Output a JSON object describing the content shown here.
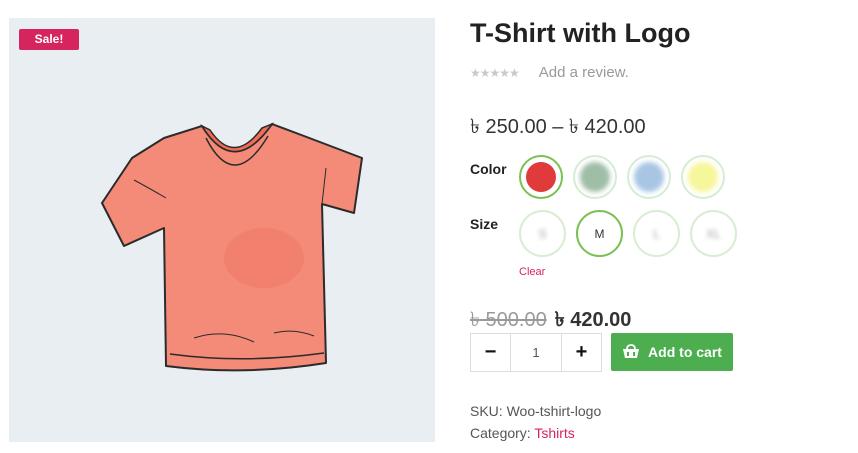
{
  "badge": {
    "sale_label": "Sale!"
  },
  "product": {
    "title": "T-Shirt with Logo",
    "rating_stars": "★★★★★",
    "review_link": "Add a review.",
    "price_range": "৳ 250.00 – ৳ 420.00",
    "old_price": "৳ 500.00",
    "new_price": "৳ 420.00"
  },
  "attributes": {
    "color_label": "Color",
    "colors": [
      {
        "name": "red",
        "hex": "#e03a3a",
        "selected": true
      },
      {
        "name": "green",
        "hex": "#7fa98a",
        "selected": false
      },
      {
        "name": "blue",
        "hex": "#8bb4dc",
        "selected": false
      },
      {
        "name": "yellow",
        "hex": "#f3f37a",
        "selected": false
      }
    ],
    "size_label": "Size",
    "sizes": [
      "S",
      "M",
      "L",
      "XL"
    ],
    "selected_size": "M",
    "clear_label": "Clear"
  },
  "cart": {
    "minus_label": "−",
    "plus_label": "+",
    "quantity": "1",
    "add_to_cart_label": "Add to cart"
  },
  "meta": {
    "sku_label": "SKU:",
    "sku_value": "Woo-tshirt-logo",
    "category_label": "Category:",
    "category_value": "Tshirts"
  },
  "colors": {
    "accent": "#d6245f",
    "button": "#4cae4f",
    "selected_border": "#79c152",
    "shirt": "#f48a78"
  },
  "icons": {
    "cart": "cart-icon",
    "minus": "minus-icon",
    "plus": "plus-icon"
  }
}
